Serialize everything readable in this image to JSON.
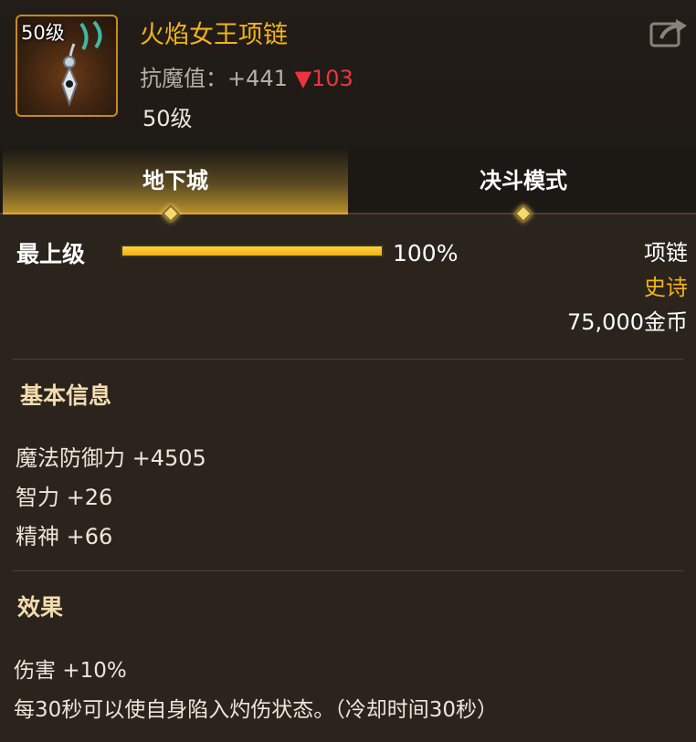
{
  "item": {
    "level_badge": "50级",
    "name": "火焰女王项链",
    "stat_label": "抗魔值：",
    "stat_value": "+441",
    "stat_change": "▼103",
    "level": "50级"
  },
  "tabs": [
    {
      "label": "地下城",
      "active": true
    },
    {
      "label": "决斗模式",
      "active": false
    }
  ],
  "grade": {
    "label": "最上级",
    "progress": 1.0,
    "percent_text": "100%"
  },
  "info": {
    "type": "项链",
    "rarity": "史诗",
    "price": "75,000金币"
  },
  "basic_info": {
    "title": "基本信息",
    "attributes": [
      "魔法防御力 +4505",
      "智力 +26",
      "精神 +66"
    ]
  },
  "effect": {
    "title": "效果",
    "lines": [
      "伤害 +10%",
      "每30秒可以使自身陷入灼伤状态。（冷却时间30秒）"
    ]
  },
  "colors": {
    "accent": "#f2b319",
    "down": "#f0343d",
    "background": "#2a241d"
  },
  "icons": {
    "share": "share-export-icon",
    "item": "necklace-icon",
    "tab_marker": "diamond-icon"
  }
}
